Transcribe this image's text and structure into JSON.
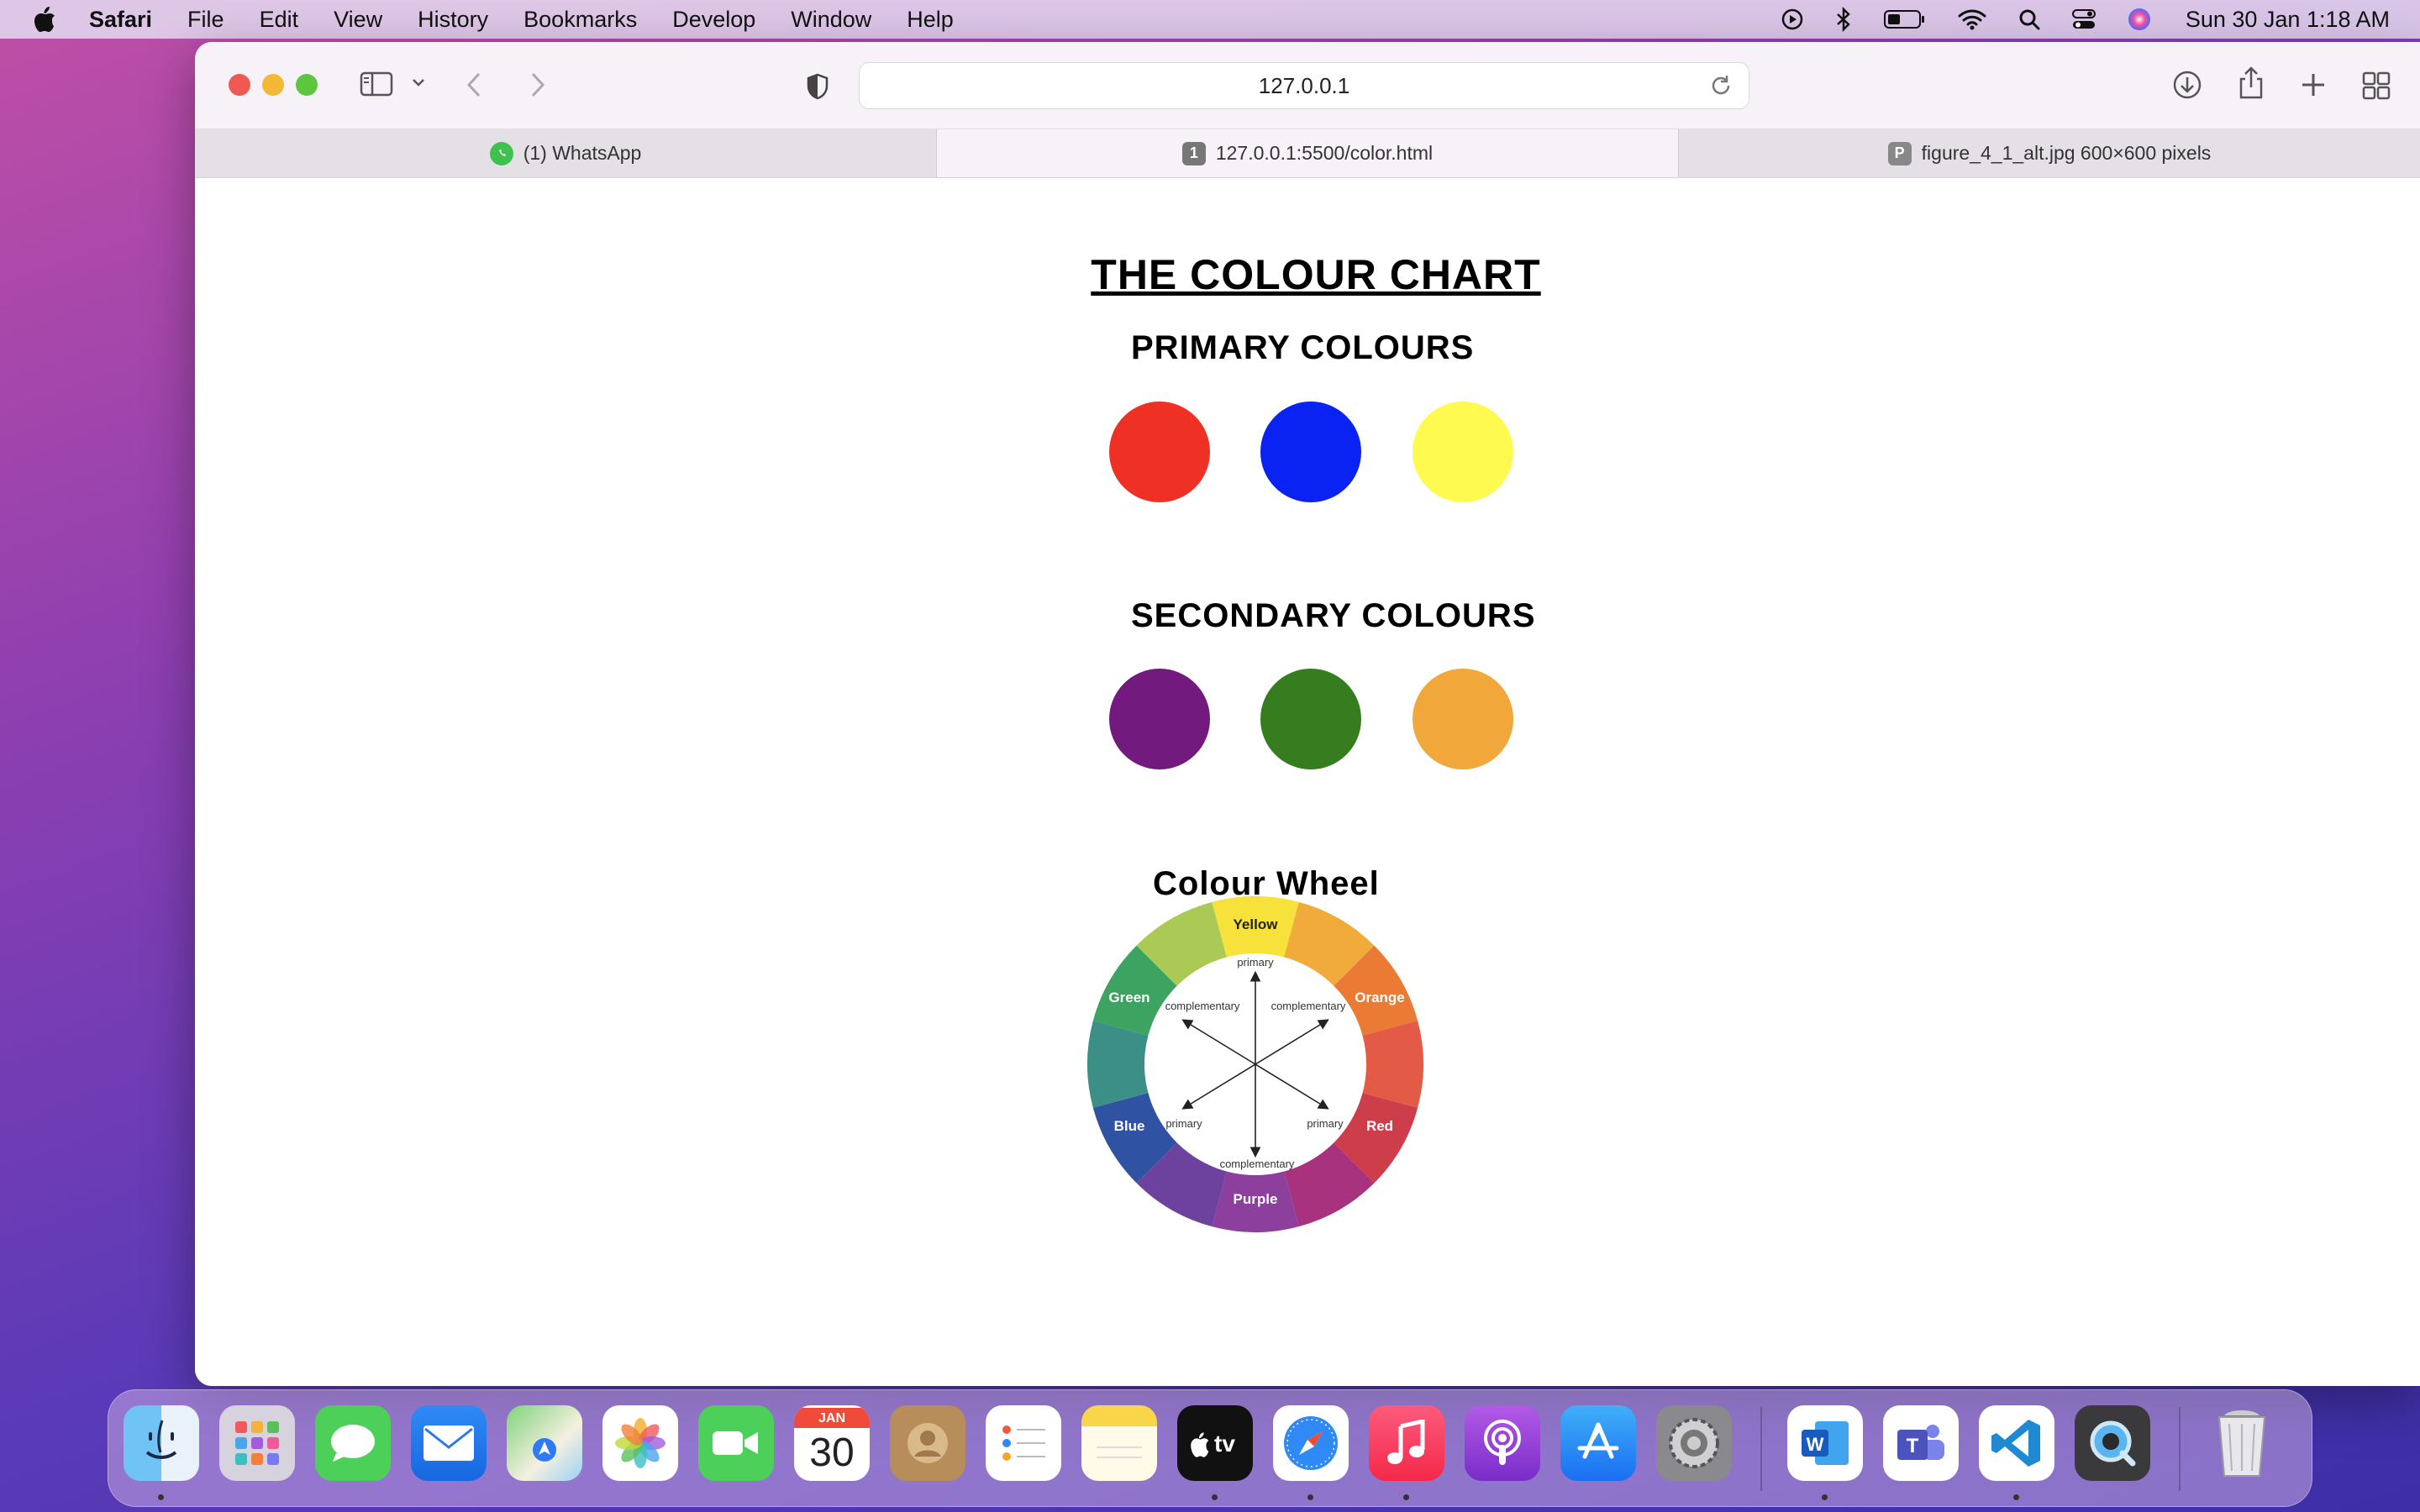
{
  "menubar": {
    "app_name": "Safari",
    "items": [
      "File",
      "Edit",
      "View",
      "History",
      "Bookmarks",
      "Develop",
      "Window",
      "Help"
    ],
    "clock": "Sun 30 Jan  1:18 AM",
    "status_icons": [
      "now-playing-icon",
      "bluetooth-icon",
      "battery-icon",
      "wifi-icon",
      "spotlight-icon",
      "control-center-icon",
      "siri-icon"
    ]
  },
  "browser": {
    "url": "127.0.0.1",
    "tabs": [
      {
        "label": "(1) WhatsApp",
        "icon": "whatsapp-icon",
        "active": false
      },
      {
        "label": "127.0.0.1:5500/color.html",
        "icon_text": "1",
        "active": true
      },
      {
        "label": "figure_4_1_alt.jpg 600×600 pixels",
        "icon_text": "P",
        "active": false
      }
    ]
  },
  "page": {
    "title": "THE COLOUR CHART",
    "primary_heading": "PRIMARY COLOURS",
    "secondary_heading": "SECONDARY COLOURS",
    "wheel_heading": "Colour Wheel",
    "primary_colors": [
      "#ee3124",
      "#0a22f2",
      "#fefa50"
    ],
    "secondary_colors": [
      "#731a7e",
      "#357d1f",
      "#f2a73a"
    ],
    "wheel": {
      "segment_labels": {
        "yellow": "Yellow",
        "orange": "Orange",
        "red": "Red",
        "purple": "Purple",
        "blue": "Blue",
        "green": "Green"
      },
      "inner_labels": {
        "top": "primary",
        "top_left": "complementary",
        "top_right": "complementary",
        "bottom_left": "primary",
        "bottom_right": "primary",
        "bottom": "complementary"
      },
      "segment_colors": [
        "#f7e23b",
        "#f0ab3a",
        "#eb7a34",
        "#e35a46",
        "#cd3e4a",
        "#a9327e",
        "#8c3f9c",
        "#6c429e",
        "#2f52a3",
        "#3c8f86",
        "#3da360",
        "#abc955"
      ]
    }
  },
  "dock": {
    "calendar_month": "JAN",
    "calendar_day": "30",
    "apps": [
      "finder-icon",
      "launchpad-icon",
      "messages-icon",
      "mail-icon",
      "maps-icon",
      "photos-icon",
      "facetime-icon",
      "calendar-icon",
      "contacts-icon",
      "reminders-icon",
      "notes-icon",
      "apple-tv-icon",
      "safari-icon",
      "music-icon",
      "podcasts-icon",
      "app-store-icon",
      "system-preferences-icon",
      "word-icon",
      "teams-icon",
      "vscode-icon",
      "quicktime-icon",
      "trash-icon"
    ]
  }
}
